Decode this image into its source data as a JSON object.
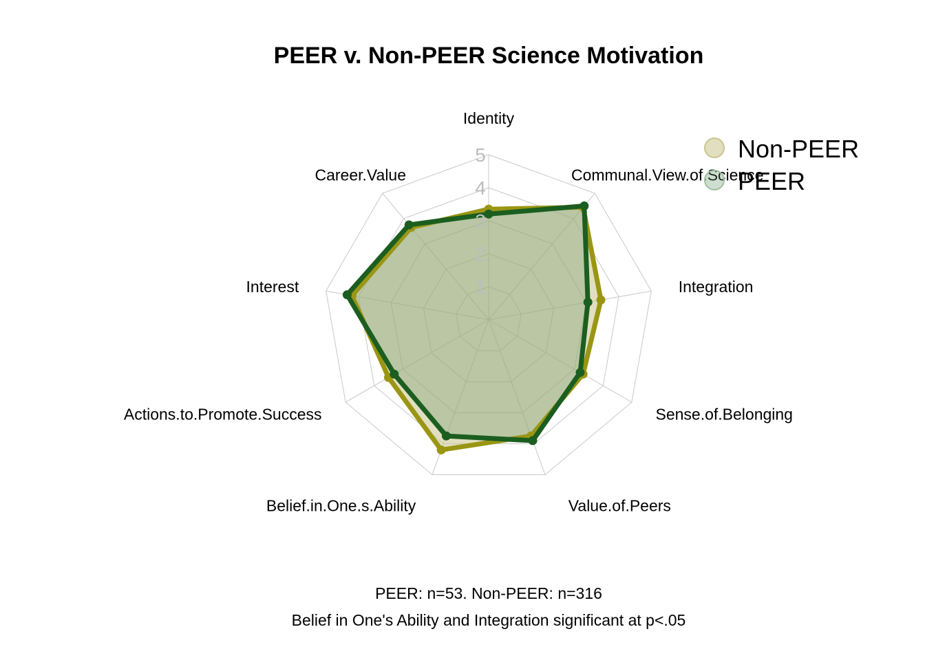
{
  "chart_data": {
    "type": "radar",
    "title": "PEER v. Non-PEER Science Motivation",
    "axes": [
      "Identity",
      "Communal.View.of.Science",
      "Integration",
      "Sense.of.Belonging",
      "Value.of.Peers",
      "Belief.in.One.s.Ability",
      "Actions.to.Promote.Success",
      "Interest",
      "Career.Value"
    ],
    "ticks": [
      "1",
      "2",
      "3",
      "4",
      "5"
    ],
    "range": [
      0,
      5
    ],
    "grid": true,
    "legend_position": "top-right",
    "series": [
      {
        "name": "Non-PEER",
        "line_color": "#9a9614",
        "fill_color": "#c9c58d",
        "values": [
          3.35,
          4.45,
          3.45,
          3.3,
          3.75,
          4.2,
          3.5,
          4.2,
          3.65
        ]
      },
      {
        "name": "PEER",
        "line_color": "#1b5e20",
        "fill_color": "#5f8f62",
        "values": [
          3.2,
          4.5,
          3.05,
          3.2,
          3.9,
          3.75,
          3.3,
          4.35,
          3.75
        ]
      }
    ],
    "captions": [
      "PEER: n=53. Non-PEER: n=316",
      "Belief in One's Ability and Integration significant at p<.05"
    ]
  }
}
